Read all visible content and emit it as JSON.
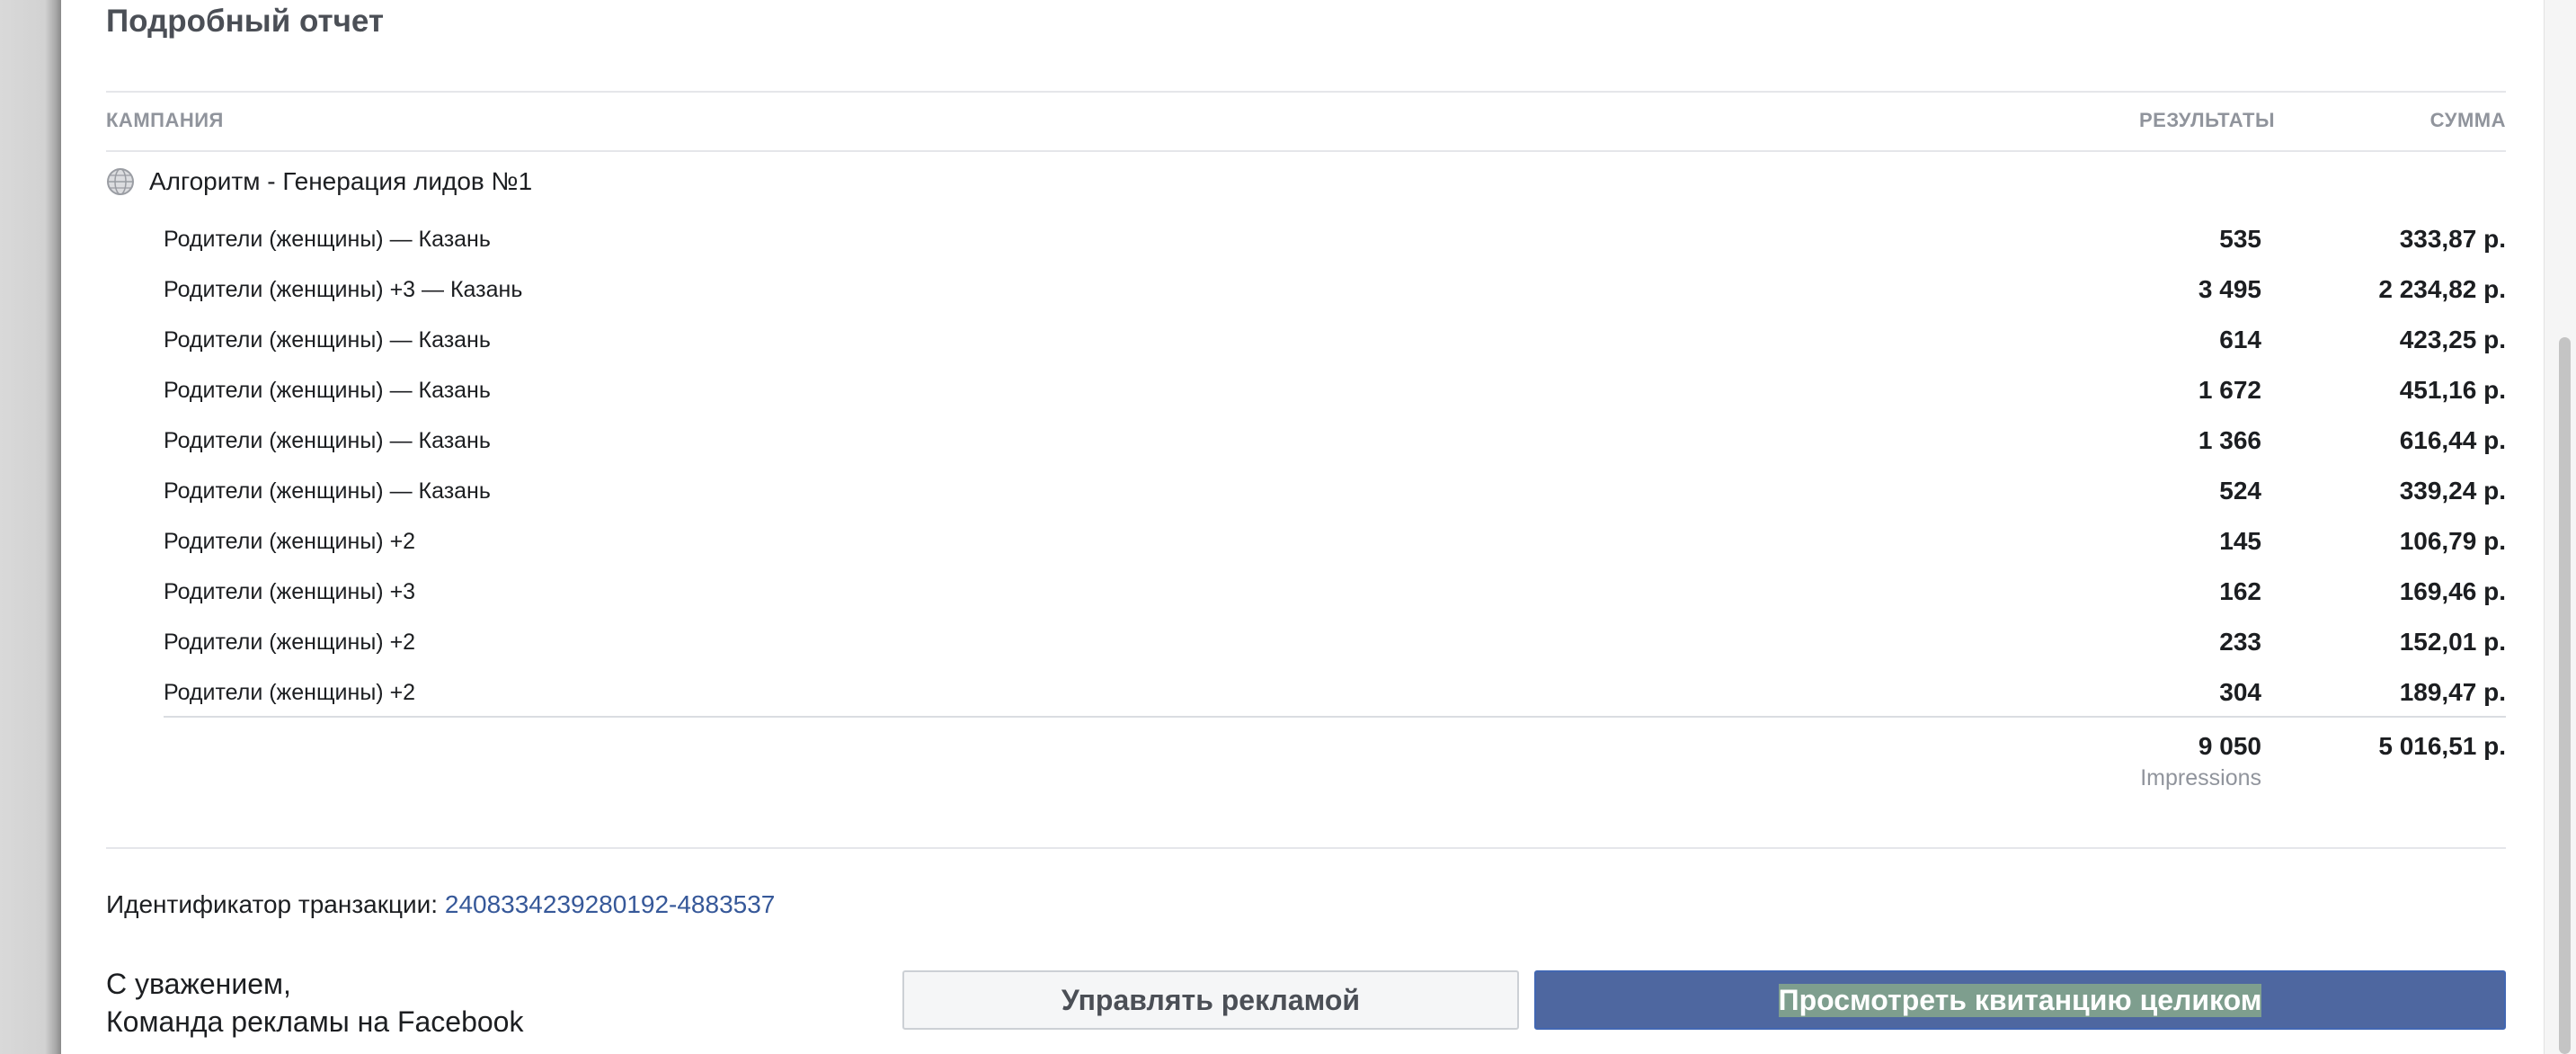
{
  "report": {
    "title": "Подробный отчет",
    "columns": {
      "campaign": "КАМПАНИЯ",
      "results": "РЕЗУЛЬТАТЫ",
      "amount": "СУММА"
    },
    "campaign": {
      "icon": "globe-icon",
      "name": "Алгоритм - Генерация лидов №1"
    },
    "ads": [
      {
        "name": "Родители (женщины) — Казань",
        "results": "535",
        "amount": "333,87 р."
      },
      {
        "name": "Родители (женщины) +3 — Казань",
        "results": "3 495",
        "amount": "2 234,82 р."
      },
      {
        "name": "Родители (женщины) — Казань",
        "results": "614",
        "amount": "423,25 р."
      },
      {
        "name": "Родители (женщины) — Казань",
        "results": "1 672",
        "amount": "451,16 р."
      },
      {
        "name": "Родители (женщины) — Казань",
        "results": "1 366",
        "amount": "616,44 р."
      },
      {
        "name": "Родители (женщины) — Казань",
        "results": "524",
        "amount": "339,24 р."
      },
      {
        "name": "Родители (женщины) +2",
        "results": "145",
        "amount": "106,79 р."
      },
      {
        "name": "Родители (женщины) +3",
        "results": "162",
        "amount": "169,46 р."
      },
      {
        "name": "Родители (женщины) +2",
        "results": "233",
        "amount": "152,01 р."
      },
      {
        "name": "Родители (женщины) +2",
        "results": "304",
        "amount": "189,47 р."
      }
    ],
    "total": {
      "results": "9 050",
      "unit": "Impressions",
      "amount": "5 016,51 р."
    }
  },
  "transaction": {
    "label": "Идентификатор транзакции: ",
    "id": "2408334239280192-4883537"
  },
  "signoff": {
    "line1": "С уважением,",
    "line2": "Команда рекламы на Facebook"
  },
  "buttons": {
    "manage": "Управлять рекламой",
    "receipt": "Просмотреть квитанцию целиком"
  },
  "colors": {
    "link": "#365899",
    "primary_button": "#4e67a0",
    "muted_text": "#90949c"
  }
}
